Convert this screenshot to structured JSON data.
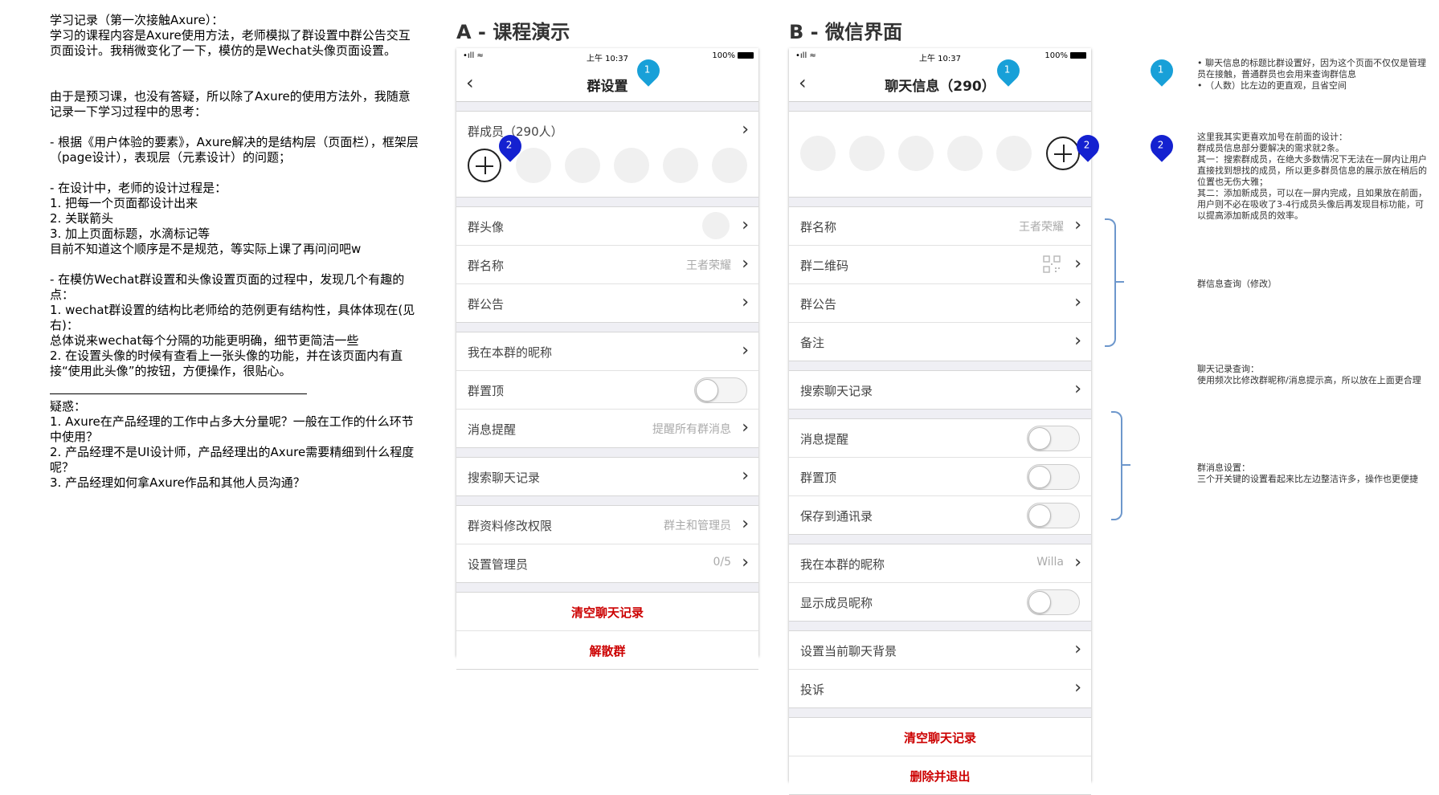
{
  "notes": {
    "lines": [
      "学习记录（第一次接触Axure）：",
      "学习的课程内容是Axure使用方法，老师模拟了群设置中群公告交互页面设计。我稍微变化了一下，模仿的是Wechat头像页面设置。",
      "",
      "由于是预习课，也没有答疑，所以除了Axure的使用方法外，我随意记录一下学习过程中的思考：",
      "",
      "- 根据《用户体验的要素》，Axure解决的是结构层（页面栏），框架层（page设计），表现层（元素设计）的问题；",
      "",
      "- 在设计中，老师的设计过程是：",
      "1. 把每一个页面都设计出来",
      "2. 关联箭头",
      "3. 加上页面标题，水滴标记等",
      "目前不知道这个顺序是不是规范，等实际上课了再问问吧w",
      "",
      "- 在模仿Wechat群设置和头像设置页面的过程中，发现几个有趣的点：",
      "1. wechat群设置的结构比老师给的范例更有结构性，具体体现在(见右)：",
      "总体说来wechat每个分隔的功能更明确，细节更简洁一些",
      "2. 在设置头像的时候有查看上一张头像的功能，并在该页面内有直接“使用此头像”的按钮，方便操作，很贴心。"
    ],
    "questions": [
      "疑惑：",
      "1. Axure在产品经理的工作中占多大分量呢？一般在工作的什么环节中使用？",
      "2. 产品经理不是UI设计师，产品经理出的Axure需要精细到什么程度呢？",
      "3. 产品经理如何拿Axure作品和其他人员沟通？"
    ]
  },
  "status": {
    "time": "上午 10:37",
    "battery": "100%",
    "signal": "•ıll ≈"
  },
  "phoneA": {
    "heading": "A - 课程演示",
    "title": "群设置",
    "members_label": "群成员（290人）",
    "rows1": [
      {
        "label": "群头像",
        "value": ""
      },
      {
        "label": "群名称",
        "value": "王者荣耀"
      },
      {
        "label": "群公告",
        "value": ""
      }
    ],
    "rows2": [
      {
        "label": "我在本群的昵称"
      },
      {
        "label": "群置顶"
      },
      {
        "label": "消息提醒",
        "value": "提醒所有群消息"
      }
    ],
    "rows3": [
      {
        "label": "搜索聊天记录"
      }
    ],
    "rows4": [
      {
        "label": "群资料修改权限",
        "value": "群主和管理员"
      },
      {
        "label": "设置管理员",
        "value": "0/5"
      }
    ],
    "actions": [
      "清空聊天记录",
      "解散群"
    ]
  },
  "phoneB": {
    "heading": "B - 微信界面",
    "title": "聊天信息（290）",
    "rows1": [
      {
        "label": "群名称",
        "value": "王者荣耀"
      },
      {
        "label": "群二维码"
      },
      {
        "label": "群公告"
      },
      {
        "label": "备注"
      }
    ],
    "rows2": [
      {
        "label": "搜索聊天记录"
      }
    ],
    "rows3": [
      {
        "label": "消息提醒"
      },
      {
        "label": "群置顶"
      },
      {
        "label": "保存到通讯录"
      }
    ],
    "rows4": [
      {
        "label": "我在本群的昵称",
        "value": "Willa"
      },
      {
        "label": "显示成员昵称"
      }
    ],
    "rows5": [
      {
        "label": "设置当前聊天背景"
      },
      {
        "label": "投诉"
      }
    ],
    "actions": [
      "清空聊天记录",
      "删除并退出"
    ]
  },
  "pins": {
    "one": "1",
    "two": "2"
  },
  "annotations": {
    "note1": [
      "• 聊天信息的标题比群设置好，因为这个页面不仅仅是管理员在接触，普通群员也会用来查询群信息",
      "• （人数）比左边的更直观，且省空间"
    ],
    "note2": [
      "这里我其实更喜欢加号在前面的设计：",
      "群成员信息部分要解决的需求就2条。",
      "其一：搜索群成员，在绝大多数情况下无法在一屏内让用户直接找到想找的成员，所以更多群员信息的展示放在稍后的位置也无伤大雅；",
      "其二：添加新成员，可以在一屏内完成，且如果放在前面，用户则不必在吸收了3-4行成员头像后再发现目标功能，可以提高添加新成员的效率。"
    ],
    "note3": [
      "群信息查询（修改）"
    ],
    "note4": [
      "聊天记录查询：",
      "使用频次比修改群昵称/消息提示高，所以放在上面更合理"
    ],
    "note5": [
      "群消息设置：",
      "三个开关键的设置看起来比左边整洁许多，操作也更便捷"
    ]
  },
  "icons": {
    "back": "chevron-left-icon",
    "chevron": "chevron-right-icon",
    "add": "add-member-icon",
    "toggle": "toggle-switch",
    "qr": "qr-code-icon",
    "pin": "map-pin-icon"
  },
  "colors": {
    "pin_cyan": "#18a0d8",
    "pin_blue": "#1421d0",
    "danger": "#cc0000",
    "bracket": "#6d97cc"
  }
}
